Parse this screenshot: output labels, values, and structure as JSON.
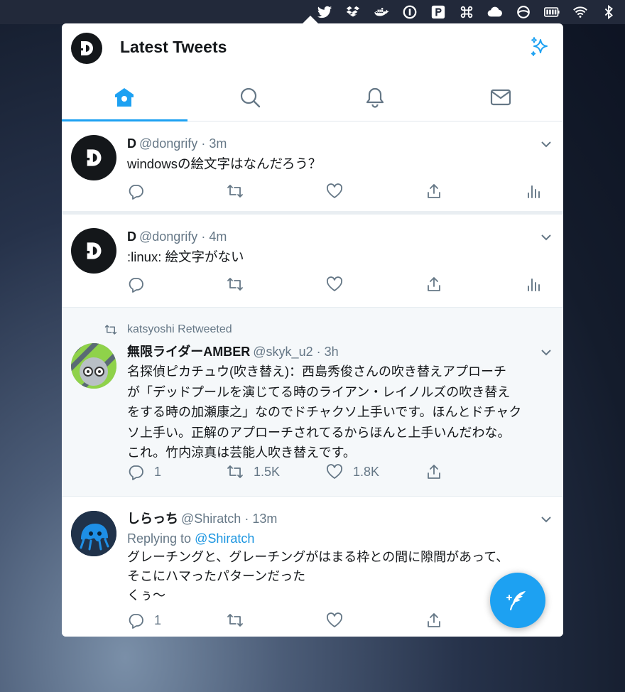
{
  "menubar": {
    "icons": [
      "twitter-icon",
      "dropbox-icon",
      "docker-icon",
      "1password-icon",
      "scrivener-icon",
      "command-icon",
      "cloud-icon",
      "sync-icon",
      "battery-icon",
      "wifi-icon",
      "bluetooth-icon"
    ]
  },
  "header": {
    "title": "Latest Tweets",
    "avatar_letter": "D"
  },
  "tabs": [
    {
      "name": "home",
      "active": true
    },
    {
      "name": "search",
      "active": false
    },
    {
      "name": "notifications",
      "active": false
    },
    {
      "name": "messages",
      "active": false
    }
  ],
  "tweets": [
    {
      "name": "D",
      "handle": "@dongrify",
      "dot": "·",
      "time": "3m",
      "text": "windowsの絵文字はなんだろう？",
      "reply_count": "",
      "retweet_count": "",
      "like_count": ""
    },
    {
      "name": "D",
      "handle": "@dongrify",
      "dot": "·",
      "time": "4m",
      "text": ":linux: 絵文字がない",
      "reply_count": "",
      "retweet_count": "",
      "like_count": ""
    },
    {
      "retweeted_by": "katsyoshi Retweeted",
      "name": "無限ライダーAMBER",
      "handle": "@skyk_u2",
      "dot": "·",
      "time": "3h",
      "text_lines": [
        "名探偵ピカチュウ(吹き替え)：西島秀俊さんの吹き替えアプローチ",
        "が「デッドプールを演じてる時のライアン・レイノルズの吹き替え",
        "をする時の加瀬康之」なのでドチャクソ上手いです。ほんとドチャク",
        "ソ上手い。正解のアプローチされてるからほんと上手いんだわな。",
        "これ。竹内涼真は芸能人吹き替えです。"
      ],
      "reply_count": "1",
      "retweet_count": "1.5K",
      "like_count": "1.8K"
    },
    {
      "name": "しらっち",
      "handle": "@Shiratch",
      "dot": "·",
      "time": "13m",
      "replying_prefix": "Replying to ",
      "replying_to": "@Shiratch",
      "text_lines": [
        "グレーチングと、グレーチングがはまる枠との間に隙間があって、",
        "そこにハマったパターンだった",
        "くぅ〜"
      ],
      "reply_count": "1",
      "retweet_count": "",
      "like_count": ""
    }
  ],
  "colors": {
    "accent": "#1da1f2",
    "text": "#14171a",
    "secondary": "#657786",
    "highlight_bg": "#f5f8fa"
  }
}
